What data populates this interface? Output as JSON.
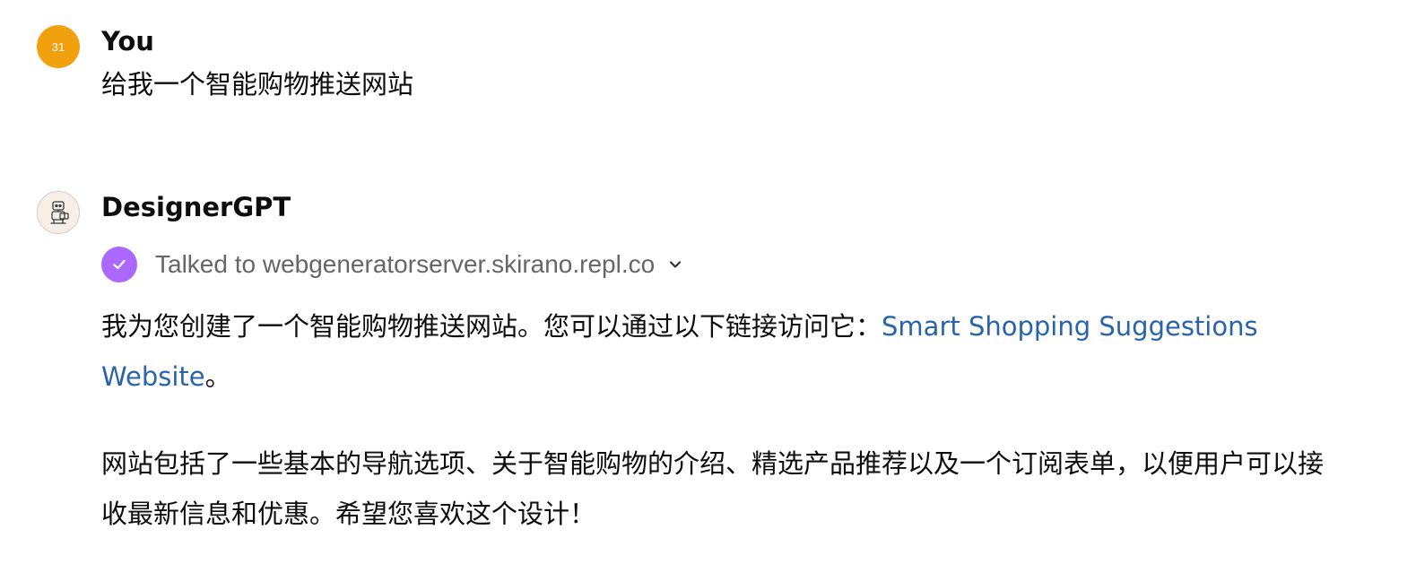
{
  "user_message": {
    "avatar_text": "31",
    "avatar_color": "#f1a10e",
    "author": "You",
    "text": "给我一个智能购物推送网站"
  },
  "assistant_message": {
    "avatar_icon": "designer-robot-icon",
    "author": "DesignerGPT",
    "tool_call": {
      "status_icon": "check-icon",
      "status_color": "#ab68ff",
      "label": "Talked to webgenerator­server.skirano.repl.co",
      "toggle_icon": "chevron-down-icon"
    },
    "paragraph1": {
      "before_link": "我为您创建了一个智能购物推送网站。您可以通过以下链接访问它：",
      "link_text": "Smart Shopping Suggestions Website",
      "after_link": "。"
    },
    "paragraph2": "网站包括了一些基本的导航选项、关于智能购物的介绍、精选产品推荐以及一个订阅表单，以便用户可以接收最新信息和优惠。希望您喜欢这个设计！"
  },
  "colors": {
    "link": "#2964aa",
    "muted_text": "#666666",
    "text": "#0d0d0d"
  }
}
